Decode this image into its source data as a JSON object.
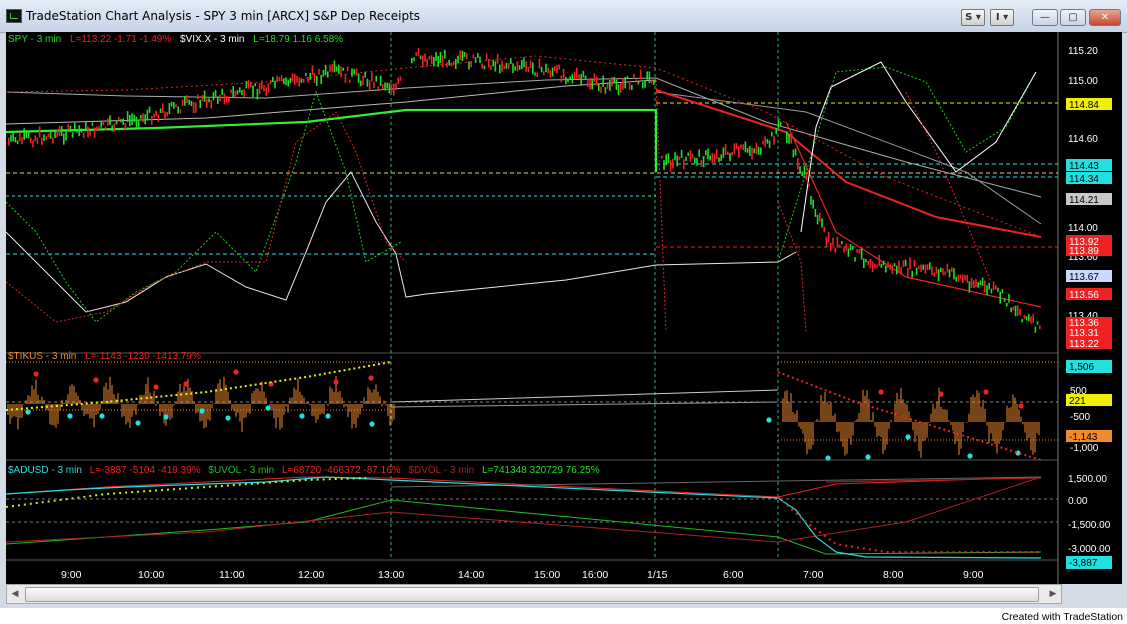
{
  "window": {
    "title": "TradeStation Chart Analysis - SPY 3 min [ARCX] S&P Dep Receipts",
    "btn_s": "S ▾",
    "btn_i": "I ▾",
    "minimize": "—",
    "maximize": "▢",
    "close": "✕"
  },
  "colors": {
    "price_green": "#22dd22",
    "price_red": "#ee2222",
    "cyan": "#22e0e0",
    "yellow": "#f0f000",
    "orange": "#f08a30"
  },
  "panels": {
    "price": {
      "symbol": "SPY - 3 min",
      "stats": "L=113.22  -1.71  -1.49%",
      "vix_symbol": "$VIX.X - 3 min",
      "vix_stats": "L=18.79  1.16  6.58%",
      "axis": [
        "115.20",
        "115.00",
        "114.60",
        "114.00",
        "113.60",
        "113.40"
      ],
      "tags": [
        {
          "text": "114.84",
          "bg": "#f0f000",
          "fg": "#000000"
        },
        {
          "text": "114.43",
          "bg": "#22e0e0",
          "fg": "#000000"
        },
        {
          "text": "114.34",
          "bg": "#22e0e0",
          "fg": "#000000"
        },
        {
          "text": "114.21",
          "bg": "#c8c8c8",
          "fg": "#000000"
        },
        {
          "text": "113.92",
          "bg": "#ee2222",
          "fg": "#ffffff"
        },
        {
          "text": "113.89",
          "bg": "#ee2222",
          "fg": "#ffffff"
        },
        {
          "text": "113.67",
          "bg": "#c8d8ff",
          "fg": "#000000"
        },
        {
          "text": "113.56",
          "bg": "#ee2222",
          "fg": "#ffffff"
        },
        {
          "text": "113.36",
          "bg": "#ee2222",
          "fg": "#ffffff"
        },
        {
          "text": "113.31",
          "bg": "#ee2222",
          "fg": "#ffffff"
        },
        {
          "text": "113.22",
          "bg": "#ee2222",
          "fg": "#ffffff"
        }
      ]
    },
    "tikus": {
      "symbol": "$TIKUS - 3 min",
      "stats": "L=-1143  -1230  -1413.79%",
      "axis": [
        "500",
        "-500",
        "-1,000"
      ],
      "tags": [
        {
          "text": "1,506",
          "bg": "#22e0e0",
          "fg": "#000000"
        },
        {
          "text": "221",
          "bg": "#f0f000",
          "fg": "#000000"
        },
        {
          "text": "-1,143",
          "bg": "#f08a30",
          "fg": "#000000"
        }
      ]
    },
    "adusd": {
      "symbol": "$ADUSD - 3 min",
      "stats": "L=-3887  -5104  -419.39%",
      "uvol_symbol": "$UVOL - 3 min",
      "uvol_stats": "L=68720  -466372  -87.16%",
      "dvol_symbol": "$DVOL - 3 min",
      "dvol_stats": "L=741348  320729  76.25%",
      "axis": [
        "1,500.00",
        "0.00",
        "-1,500.00",
        "-3,000.00"
      ],
      "tags": [
        {
          "text": "-3,887",
          "bg": "#22e0e0",
          "fg": "#000000"
        }
      ]
    }
  },
  "time_axis": [
    "9:00",
    "10:00",
    "11:00",
    "12:00",
    "13:00",
    "14:00",
    "15:00",
    "16:00",
    "1/15",
    "6:00",
    "7:00",
    "8:00",
    "9:00"
  ],
  "footer": {
    "credit": "Created with TradeStation"
  }
}
